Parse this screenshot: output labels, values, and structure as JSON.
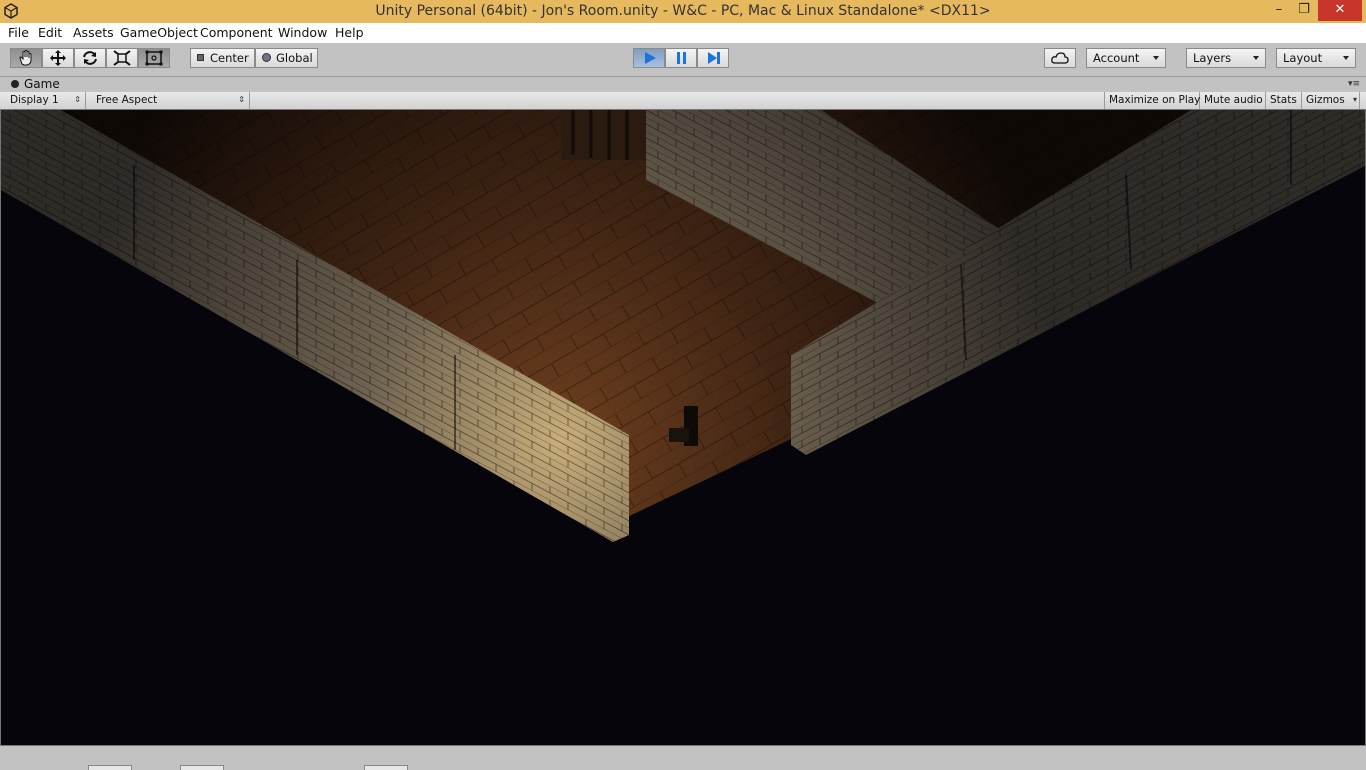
{
  "window": {
    "title": "Unity Personal (64bit) - Jon's Room.unity - W&C - PC, Mac & Linux Standalone* <DX11>",
    "minimize": "–",
    "maximize": "❐",
    "close": "✕"
  },
  "menu": {
    "items": [
      "File",
      "Edit",
      "Assets",
      "GameObject",
      "Component",
      "Window",
      "Help"
    ]
  },
  "toolbar": {
    "tools": [
      "hand-icon",
      "move-icon",
      "rotate-icon",
      "scale-icon",
      "rect-icon"
    ],
    "pivot_label": "Center",
    "space_label": "Global",
    "playback": [
      "play-icon",
      "pause-icon",
      "step-icon"
    ],
    "cloud": "cloud-icon",
    "account_label": "Account",
    "layers_label": "Layers",
    "layout_label": "Layout"
  },
  "tab": {
    "title": "Game"
  },
  "game_view": {
    "display_label": "Display 1",
    "aspect_label": "Free Aspect",
    "maximize_label": "Maximize on Play",
    "mute_label": "Mute audio",
    "stats_label": "Stats",
    "gizmos_label": "Gizmos"
  },
  "colors": {
    "title_bar": "#e7b95f",
    "close_button": "#c7352b",
    "play_active": "#7f9cc2",
    "viewport_background": "#05050b"
  }
}
